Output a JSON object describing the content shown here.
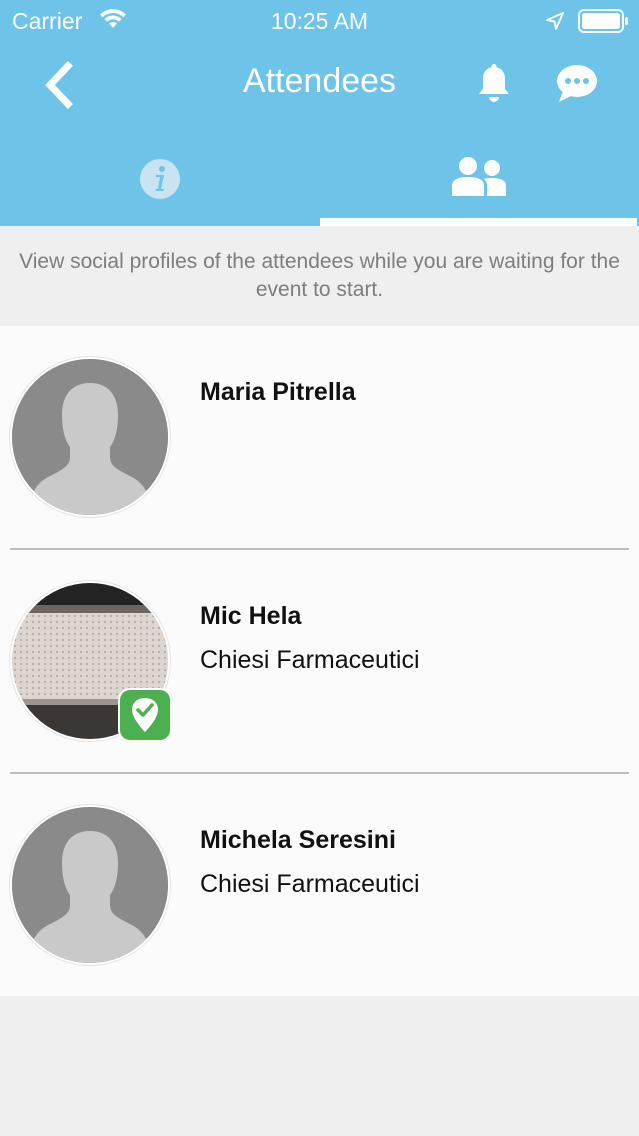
{
  "status_bar": {
    "carrier": "Carrier",
    "time": "10:25 AM"
  },
  "nav": {
    "title": "Attendees",
    "back_icon": "chevron-left-icon",
    "bell_icon": "bell-icon",
    "chat_icon": "chat-bubble-icon"
  },
  "tabs": [
    {
      "icon": "info-icon",
      "selected": false
    },
    {
      "icon": "attendees-icon",
      "selected": true
    }
  ],
  "intro_text": "View social profiles of the attendees while you are waiting for the event to start.",
  "attendees": [
    {
      "name": "Maria Pitrella",
      "company": "",
      "avatar": "placeholder-avatar",
      "badge": false
    },
    {
      "name": "Mic Hela",
      "company": "Chiesi Farmaceutici",
      "avatar": "photo",
      "badge": true,
      "badge_icon": "checkin-badge-icon"
    },
    {
      "name": "Michela Seresini",
      "company": "Chiesi Farmaceutici",
      "avatar": "placeholder-avatar",
      "badge": false
    }
  ],
  "colors": {
    "header": "#6ec3e9",
    "badge": "#4caf50",
    "intro_text": "#7d7d7d",
    "list_background": "#fbfbfb",
    "page_background": "#efefef"
  }
}
